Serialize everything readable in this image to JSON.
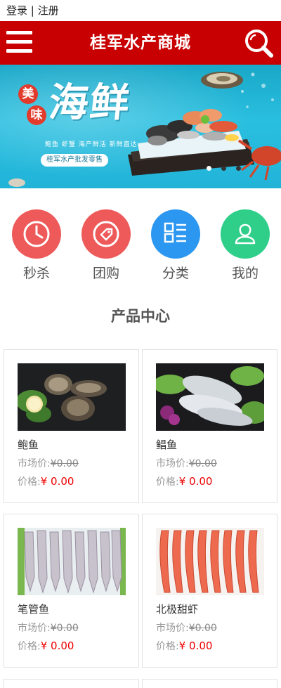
{
  "top_bar": {
    "login": "登录",
    "separator": "|",
    "register": "注册"
  },
  "header": {
    "title": "桂军水产商城",
    "menu_icon": "hamburger-menu-icon",
    "search_icon": "search-icon",
    "color": "#c80002"
  },
  "banner": {
    "badge_chars": [
      "美",
      "味"
    ],
    "headline": "海鲜",
    "tagline": "鲍鱼 虾蟹  海产鲜活  新鲜直达",
    "pill_text": "桂军水产批发零售",
    "slide_count": 3,
    "active_slide": 1
  },
  "quick_nav": [
    {
      "label": "秒杀",
      "icon": "clock-icon",
      "color": "#ee5a5a"
    },
    {
      "label": "团购",
      "icon": "tag-icon",
      "color": "#ee5a5a"
    },
    {
      "label": "分类",
      "icon": "category-list-icon",
      "color": "#2c97f0"
    },
    {
      "label": "我的",
      "icon": "user-icon",
      "color": "#2fcf8a"
    }
  ],
  "section_title": "产品中心",
  "products": [
    {
      "name": "鲍鱼",
      "market_label": "市场价:",
      "market_price": "¥0.00",
      "price_label": "价格:",
      "price": "¥ 0.00"
    },
    {
      "name": "鲳鱼",
      "market_label": "市场价:",
      "market_price": "¥0.00",
      "price_label": "价格:",
      "price": "¥ 0.00"
    },
    {
      "name": "笔管鱼",
      "market_label": "市场价:",
      "market_price": "¥0.00",
      "price_label": "价格:",
      "price": "¥ 0.00"
    },
    {
      "name": "北极甜虾",
      "market_label": "市场价:",
      "market_price": "¥0.00",
      "price_label": "价格:",
      "price": "¥ 0.00"
    }
  ]
}
